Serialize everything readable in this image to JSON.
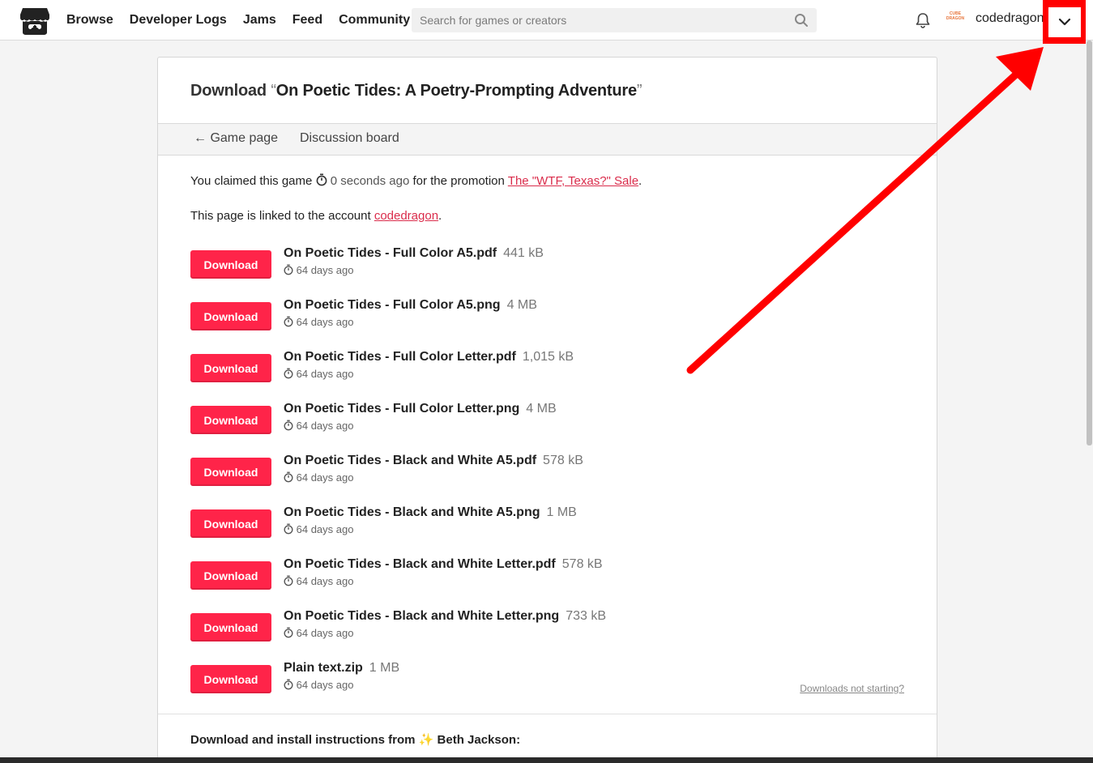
{
  "header": {
    "nav": [
      "Browse",
      "Developer Logs",
      "Jams",
      "Feed",
      "Community"
    ],
    "search_placeholder": "Search for games or creators",
    "avatar_text_1": "CUBE",
    "avatar_text_2": "DRAGON",
    "username": "codedragon"
  },
  "page": {
    "title_prefix": "Download",
    "open_quote": "“",
    "game_title": "On Poetic Tides: A Poetry-Prompting Adventure",
    "close_quote": "”",
    "tabs": {
      "back": "← Game page",
      "discussion": "Discussion board"
    },
    "claim": {
      "prefix": "You claimed this game",
      "time": "0 seconds ago",
      "middle": "for the promotion",
      "promo": "The \"WTF, Texas?\" Sale",
      "suffix": "."
    },
    "linked": {
      "prefix": "This page is linked to the account",
      "account": "codedragon",
      "suffix": "."
    },
    "download_label": "Download",
    "files": [
      {
        "name": "On Poetic Tides - Full Color A5.pdf",
        "size": "441 kB",
        "age": "64 days ago"
      },
      {
        "name": "On Poetic Tides - Full Color A5.png",
        "size": "4 MB",
        "age": "64 days ago"
      },
      {
        "name": "On Poetic Tides - Full Color Letter.pdf",
        "size": "1,015 kB",
        "age": "64 days ago"
      },
      {
        "name": "On Poetic Tides - Full Color Letter.png",
        "size": "4 MB",
        "age": "64 days ago"
      },
      {
        "name": "On Poetic Tides - Black and White A5.pdf",
        "size": "578 kB",
        "age": "64 days ago"
      },
      {
        "name": "On Poetic Tides - Black and White A5.png",
        "size": "1 MB",
        "age": "64 days ago"
      },
      {
        "name": "On Poetic Tides - Black and White Letter.pdf",
        "size": "578 kB",
        "age": "64 days ago"
      },
      {
        "name": "On Poetic Tides - Black and White Letter.png",
        "size": "733 kB",
        "age": "64 days ago"
      },
      {
        "name": "Plain text.zip",
        "size": "1 MB",
        "age": "64 days ago"
      }
    ],
    "not_starting": "Downloads not starting?",
    "instructions": "Download and install instructions from ✨ Beth Jackson:"
  },
  "colors": {
    "accent": "#ff2449",
    "link": "#da2c4b",
    "annotation": "#ff0000"
  }
}
